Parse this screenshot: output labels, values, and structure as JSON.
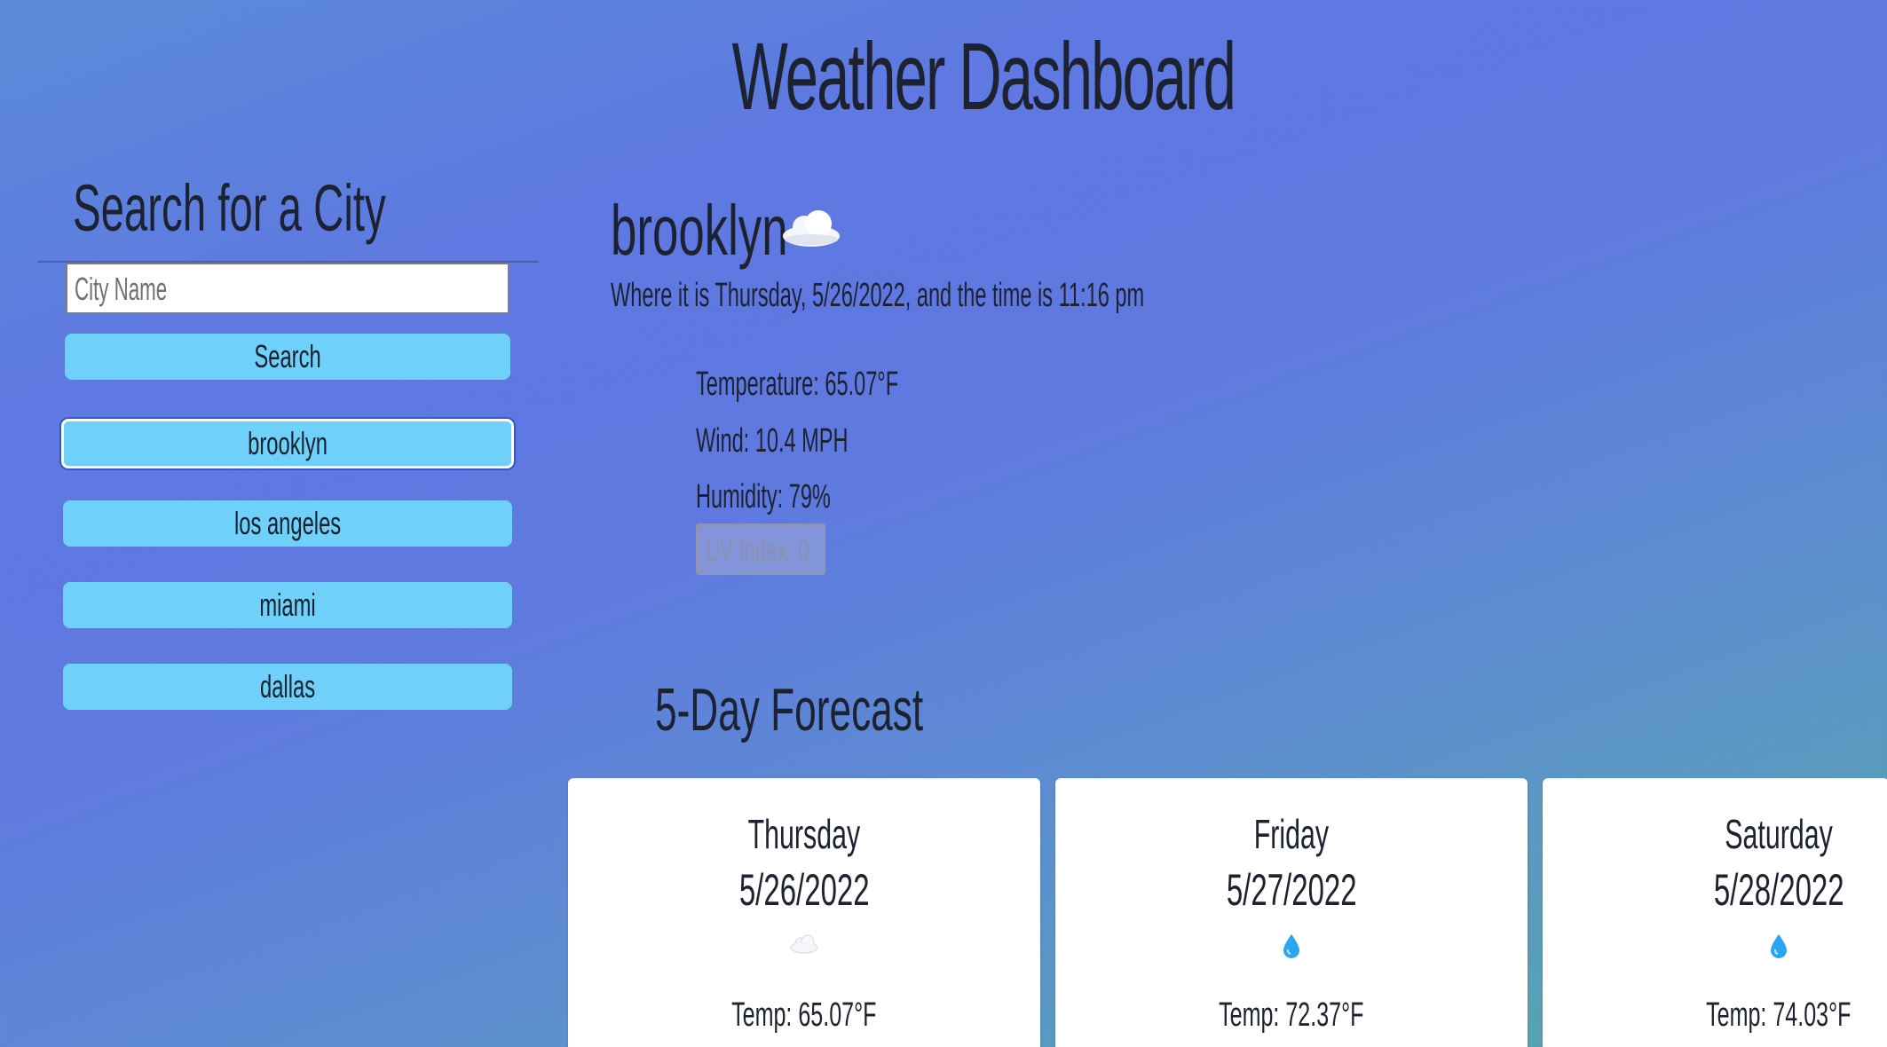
{
  "header": {
    "title": "Weather Dashboard"
  },
  "sidebar": {
    "heading": "Search for a City",
    "search": {
      "placeholder": "City Name",
      "value": ""
    },
    "search_button_label": "Search",
    "history": [
      {
        "label": "brooklyn",
        "active": true
      },
      {
        "label": "los angeles",
        "active": false
      },
      {
        "label": "miami",
        "active": false
      },
      {
        "label": "dallas",
        "active": false
      }
    ]
  },
  "current": {
    "city": "brooklyn",
    "icon": "cloud-icon",
    "datetime": "Where it is Thursday, 5/26/2022, and the time is 11:16 pm",
    "temperature": "Temperature: 65.07°F",
    "wind": "Wind: 10.4 MPH",
    "humidity": "Humidity: 79%",
    "uv_index": "UV Index: 0"
  },
  "forecast": {
    "heading": "5-Day Forecast",
    "days": [
      {
        "day": "Thursday",
        "date": "5/26/2022",
        "icon": "cloud-icon",
        "temp": "Temp: 65.07°F"
      },
      {
        "day": "Friday",
        "date": "5/27/2022",
        "icon": "droplet-icon",
        "temp": "Temp: 72.37°F"
      },
      {
        "day": "Saturday",
        "date": "5/28/2022",
        "icon": "droplet-icon",
        "temp": "Temp: 74.03°F"
      }
    ]
  },
  "colors": {
    "button": "#6fd0f9",
    "text": "#1d2230",
    "droplet": "#2aa6f0"
  }
}
